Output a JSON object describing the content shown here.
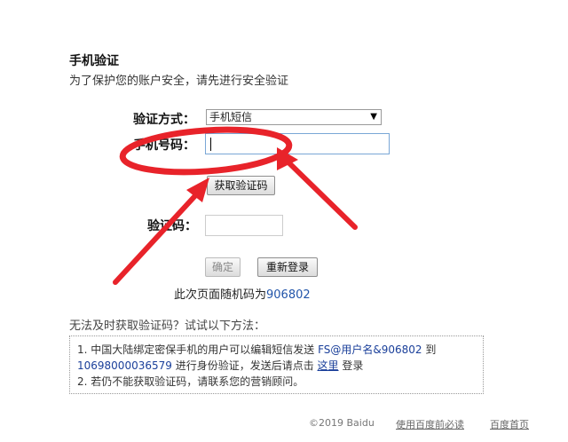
{
  "header": {
    "title": "手机验证",
    "subtitle": "为了保护您的账户安全，请先进行安全验证"
  },
  "form": {
    "method_label": "验证方式：",
    "method_value": "手机短信",
    "phone_label": "手机号码：",
    "phone_value": "",
    "get_code_label": "获取验证码",
    "code_label": "验证码：",
    "code_value": "",
    "confirm_label": "确定",
    "relogin_label": "重新登录",
    "random_prefix": "此次页面随机码为",
    "random_code": "906802"
  },
  "help": {
    "title": "无法及时获取验证码？试试以下方法：",
    "line1_a": "1. 中国大陆绑定密保手机的用户可以编辑短信发送 ",
    "line1_b": "FS@用户名&906802",
    "line1_c": " 到",
    "line2_a": "10698000036579",
    "line2_b": " 进行身份验证，发送后请点击 ",
    "line2_link": "这里",
    "line2_c": " 登录",
    "line3": "2. 若仍不能获取验证码，请联系您的营销顾问。"
  },
  "footer": {
    "copyright": "©2019  Baidu",
    "link1": "使用百度前必读",
    "link2": "百度首页"
  },
  "colors": {
    "annotation": "#e8232a",
    "link": "#1a3f9a"
  }
}
